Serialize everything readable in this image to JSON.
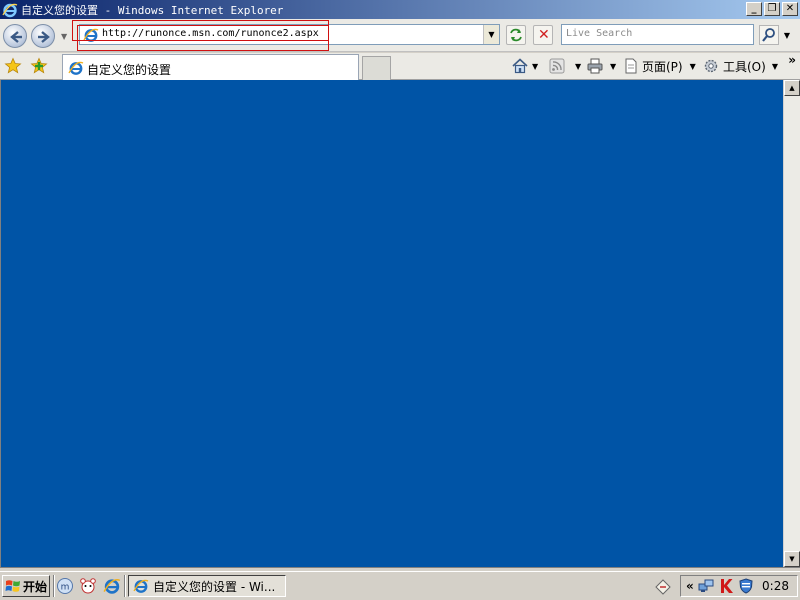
{
  "window": {
    "title": "自定义您的设置 - Windows Internet Explorer",
    "controls": {
      "minimize": "_",
      "maximize": "❐",
      "close": "✕"
    }
  },
  "navigation": {
    "back_icon": "back-arrow-icon",
    "forward_icon": "forward-arrow-icon",
    "address_url": "http://runonce.msn.com/runonce2.aspx",
    "search_placeholder": "Live Search",
    "highlight_color": "#d01010"
  },
  "tabs": [
    {
      "label": "自定义您的设置",
      "active": true
    }
  ],
  "commands": {
    "page_label": "页面(P)",
    "tools_label": "工具(O)"
  },
  "content": {
    "background_color": "#0054a6"
  },
  "taskbar": {
    "start_label": "开始",
    "task_label": "自定义您的设置 - Wi...",
    "clock": "0:28"
  }
}
